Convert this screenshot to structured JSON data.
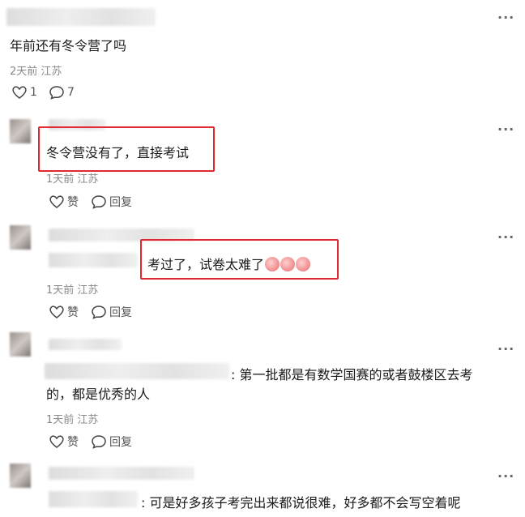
{
  "post": {
    "text": "年前还有冬令营了吗",
    "meta": "2天前 江苏",
    "likes": "1",
    "comments": "7"
  },
  "comments": [
    {
      "text": "冬令营没有了，直接考试",
      "meta": "1天前 江苏",
      "like_label": "赞",
      "reply_label": "回复"
    },
    {
      "text": "考过了，试卷太难了",
      "meta": "1天前 江苏",
      "like_label": "赞",
      "reply_label": "回复"
    },
    {
      "text_line1": ": 第一批都是有数学国赛的或者鼓楼区去考",
      "text_line2": "的，都是优秀的人",
      "meta": "1天前 江苏",
      "like_label": "赞",
      "reply_label": "回复"
    },
    {
      "text": ": 可是好多孩子考完出来都说很难，好多都不会写空着呢"
    }
  ],
  "icons": {
    "more": "more-icon",
    "heart": "heart-icon",
    "chat": "chat-bubble-icon",
    "emoji": "crying-face-emoji"
  },
  "colors": {
    "highlight": "#e0282e"
  }
}
